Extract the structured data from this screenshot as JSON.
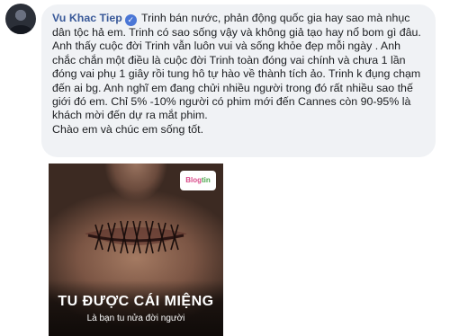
{
  "comment": {
    "author": "Vu Khac Tiep",
    "verified_icon": "verified-badge-icon",
    "paragraph_1": "Trinh bán nước, phản động quốc gia hay sao mà nhục dân tộc hả em. Trinh có sao sống vậy và không giả tạo hay nổ bom gì đâu. Anh thấy cuộc đời Trinh vẫn luôn vui và sống khỏe đẹp mỗi ngày . Anh chắc chắn một điều là cuộc đời Trinh toàn đóng vai chính và chưa 1 lần đóng vai phụ 1 giây rồi tung hô tự hào về thành tích ảo. Trinh k đụng chạm đến ai bg. Anh nghĩ em đang chửi nhiều người trong đó rất nhiều sao thế giới đó em. Chỉ 5% -10% người có phim mới đến Cannes còn 90-95% là khách mời đến dự ra mắt phim.",
    "paragraph_2": "Chào em và chúc em sống tốt."
  },
  "attachment": {
    "logo_text_1": "Blog",
    "logo_text_2": "tin",
    "caption_title": "TU ĐƯỢC CÁI MIỆNG",
    "caption_subtitle": "Là bạn tu nửa đời người"
  },
  "colors": {
    "author": "#385898",
    "bubble": "#f0f2f5",
    "verified": "#4a76d6"
  }
}
